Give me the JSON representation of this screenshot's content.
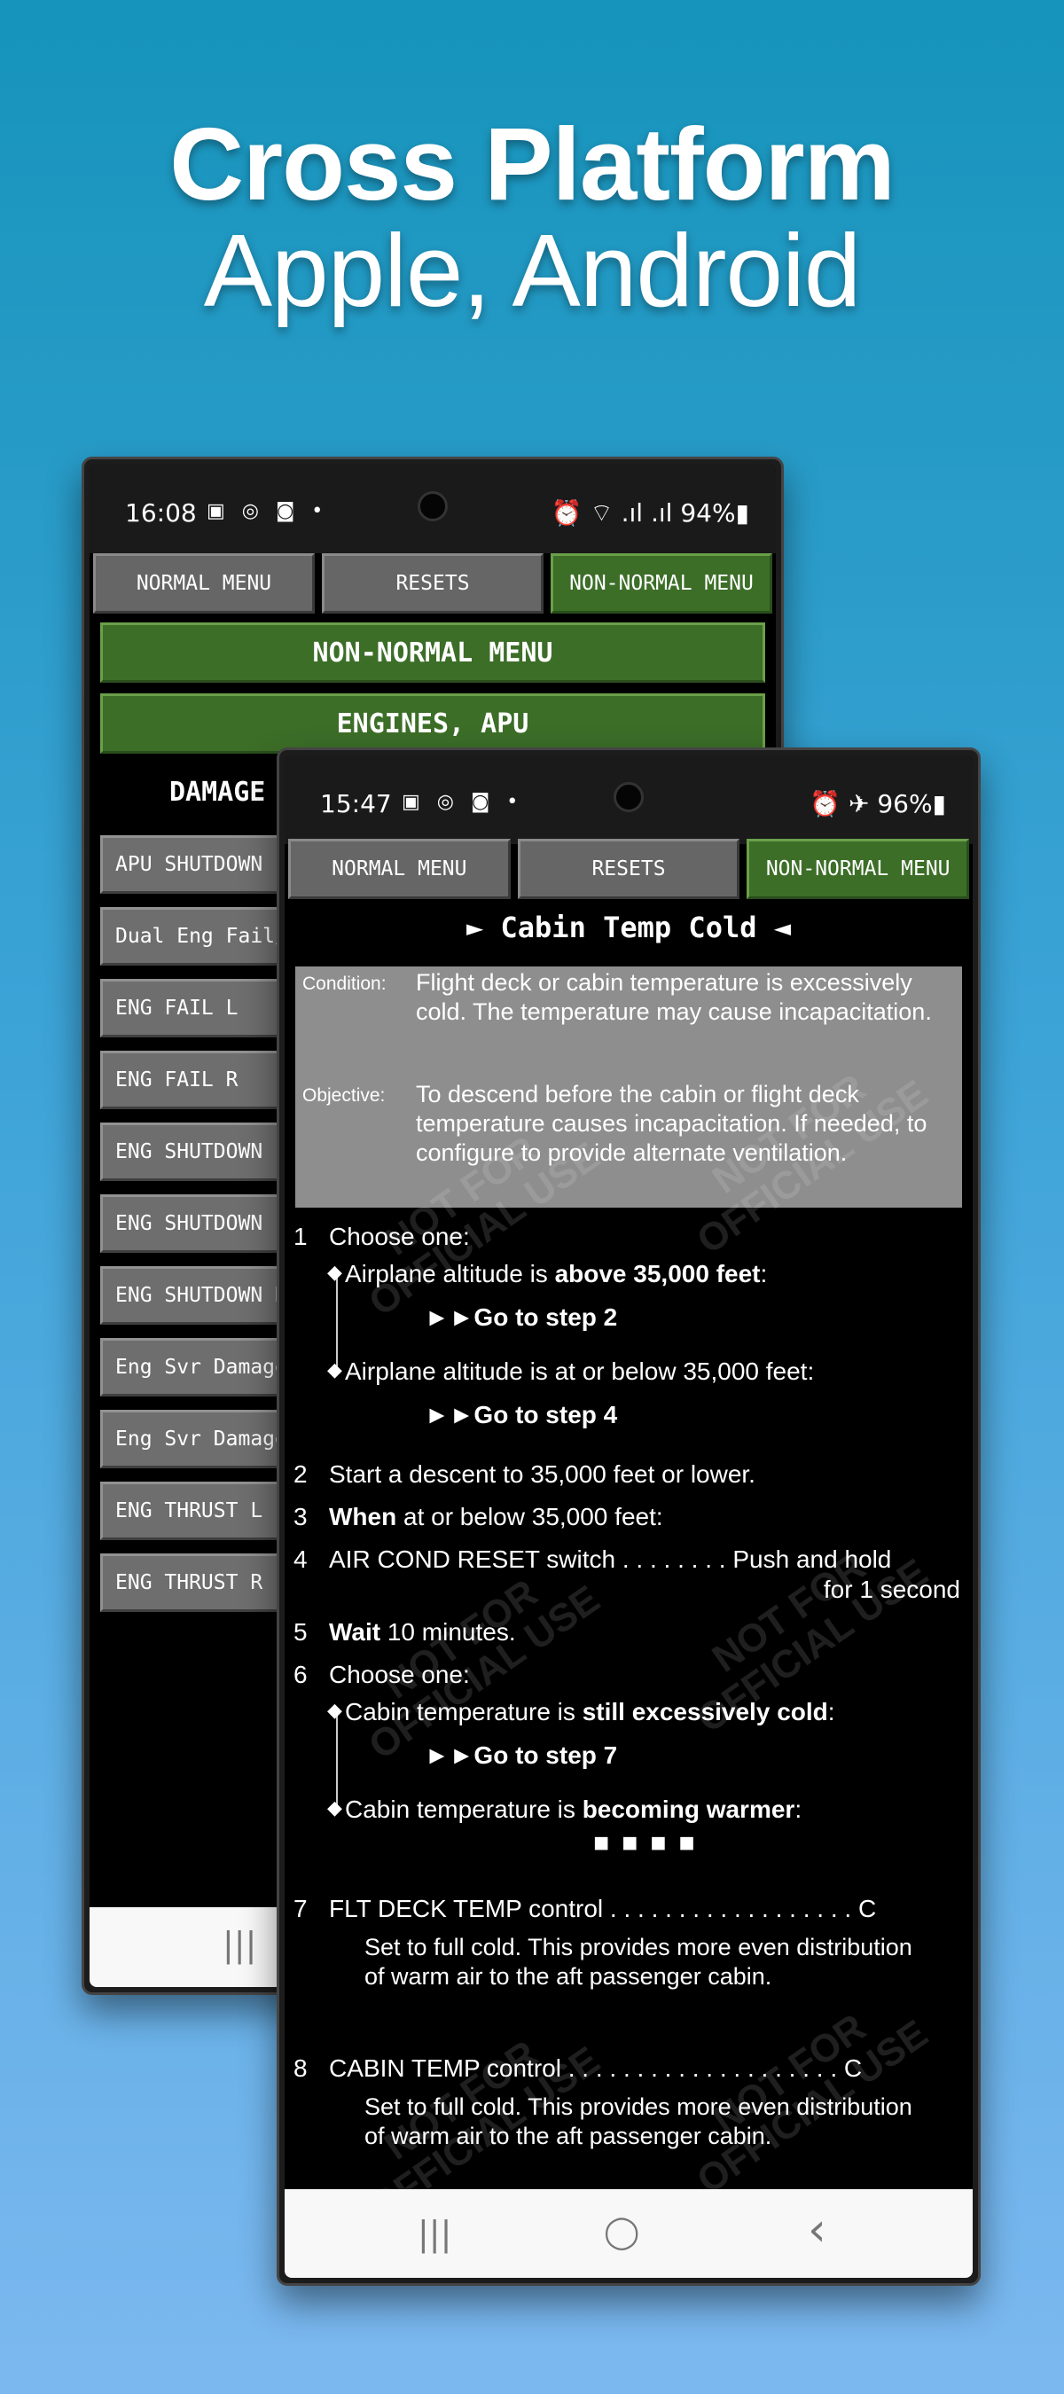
{
  "headline": {
    "line1": "Cross Platform",
    "line2": "Apple, Android"
  },
  "back_phone": {
    "status": {
      "time": "16:08",
      "icons": "▣ ◎ ◙ •",
      "right": "⏰ ⌔ .ıl .ıl 94%▮"
    },
    "tabs": [
      "NORMAL MENU",
      "RESETS",
      "NON-NORMAL MENU"
    ],
    "header1": "NON-NORMAL MENU",
    "header2": "ENGINES, APU",
    "section": "DAMAGE",
    "items": [
      "APU SHUTDOWN",
      "Dual Eng Fail/",
      "ENG FAIL L",
      "ENG FAIL R",
      "ENG SHUTDOWN",
      "ENG SHUTDOWN L",
      "ENG SHUTDOWN R",
      "Eng Svr Damage",
      "Eng Svr Damage",
      "ENG THRUST L",
      "ENG THRUST R"
    ],
    "nav": {
      "recents": "|||"
    }
  },
  "front_phone": {
    "status": {
      "time": "15:47",
      "icons": "▣ ◎ ◙ •",
      "right": "⏰ ✈ 96%▮"
    },
    "tabs": [
      "NORMAL MENU",
      "RESETS",
      "NON-NORMAL MENU"
    ],
    "title": "► Cabin Temp Cold ◄",
    "condition_label": "Condition:",
    "condition_text": "Flight deck or cabin temperature is excessively cold. The temperature may cause incapacitation.",
    "objective_label": "Objective:",
    "objective_text": "To descend before the cabin or flight deck temperature causes incapacitation. If needed, to configure to provide alternate ventilation.",
    "steps": {
      "s1_num": "1",
      "s1_text": "Choose one:",
      "s1_opt1_pre": "Airplane altitude is ",
      "s1_opt1_bold": "above 35,000 feet",
      "s1_opt1_post": ":",
      "s1_goto1": "►►Go to step 2",
      "s1_opt2": "Airplane altitude is at or below 35,000 feet:",
      "s1_goto2": "►►Go to step 4",
      "s2_num": "2",
      "s2_text": "Start a descent to 35,000 feet or lower.",
      "s3_num": "3",
      "s3_bold": "When",
      "s3_text": " at or below 35,000 feet:",
      "s4_num": "4",
      "s4_text": "AIR COND RESET switch . . . . . . . . Push and hold",
      "s4_text2": "for 1 second",
      "s5_num": "5",
      "s5_bold": "Wait",
      "s5_text": " 10 minutes.",
      "s6_num": "6",
      "s6_text": "Choose one:",
      "s6_opt1_pre": "Cabin temperature is ",
      "s6_opt1_bold": "still excessively cold",
      "s6_opt1_post": ":",
      "s6_goto1": "►►Go to step 7",
      "s6_opt2_pre": "Cabin temperature is ",
      "s6_opt2_bold": "becoming warmer",
      "s6_opt2_post": ":",
      "s6_end": "■■■■",
      "s7_num": "7",
      "s7_text": "FLT DECK TEMP control . . . . . . . . . . . . . . . . . . C",
      "s7_note": "Set to full cold. This provides more even distribution of warm air to the aft passenger cabin.",
      "s8_num": "8",
      "s8_text": "CABIN TEMP control . . . . . . . . . . . . . . . . . . . . C",
      "s8_note": "Set to full cold. This provides more even distribution of warm air to the aft passenger cabin."
    },
    "watermark": "NOT FOR\nOFFICIAL USE",
    "nav": {
      "recents": "|||",
      "home": "◯",
      "back": "‹"
    }
  }
}
